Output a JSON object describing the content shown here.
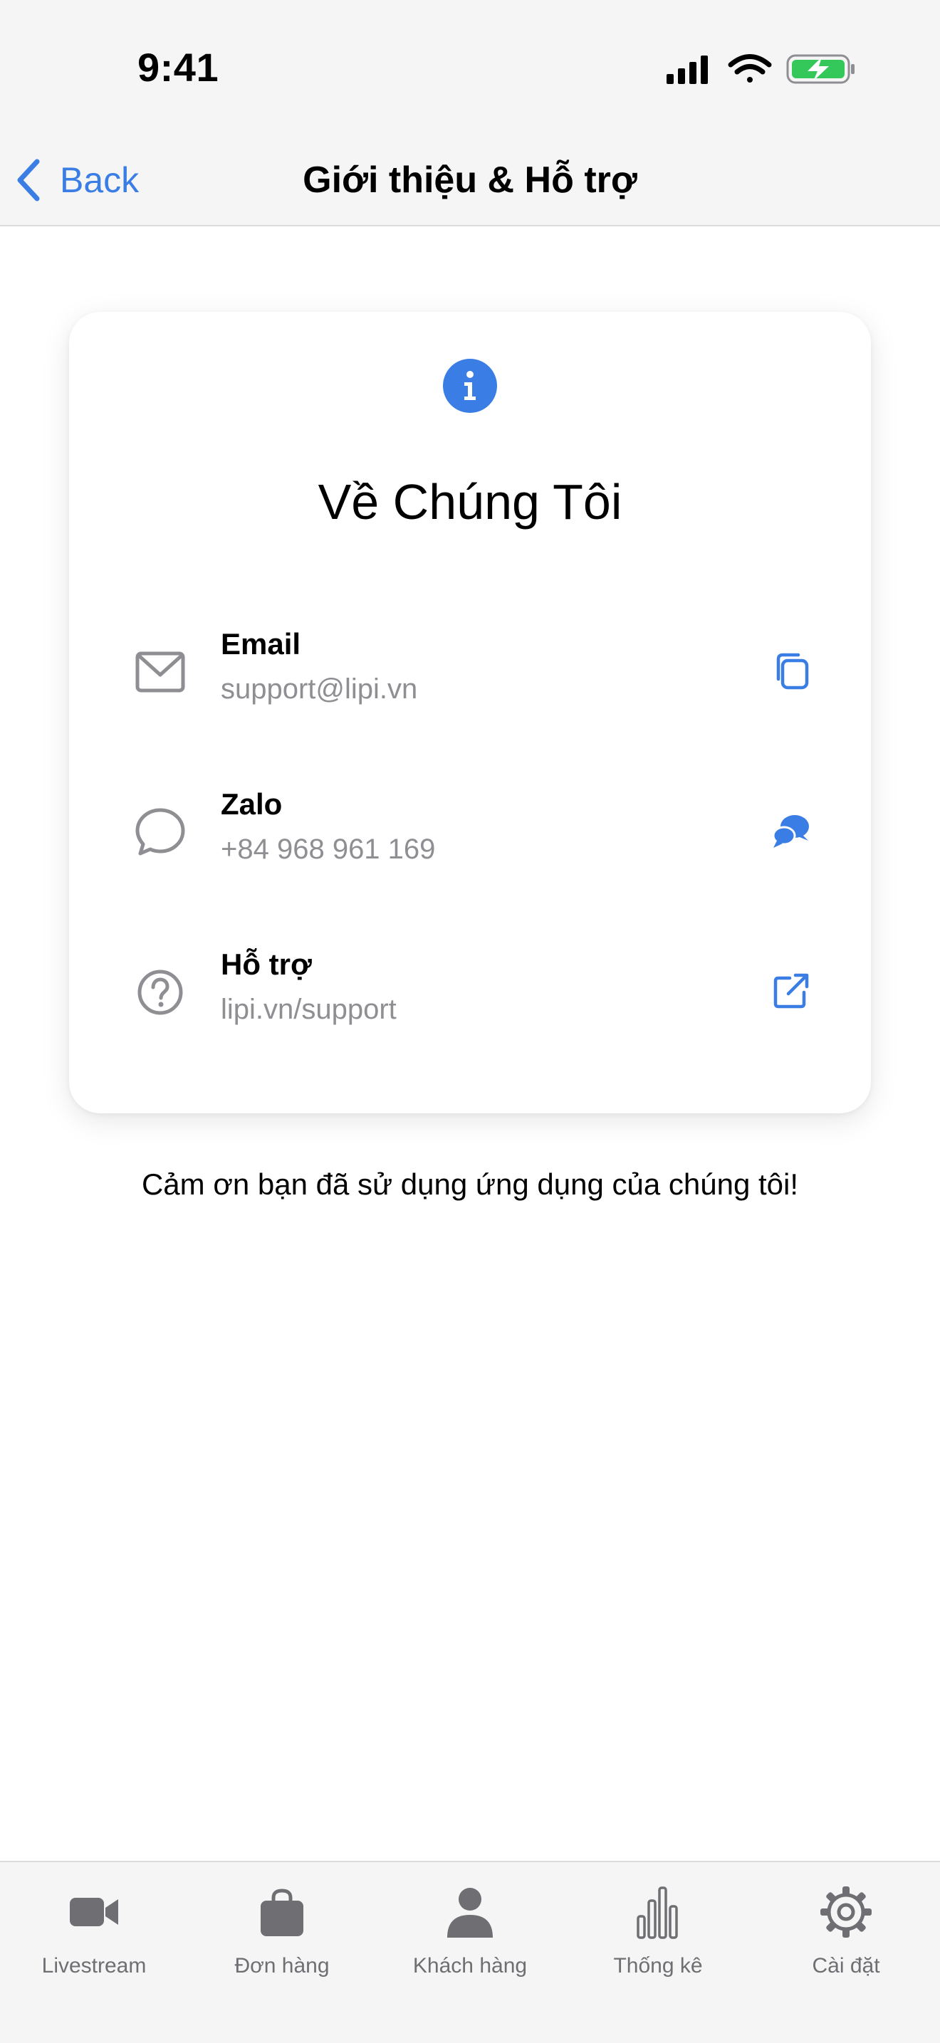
{
  "status_bar": {
    "time": "9:41",
    "battery_color": "#34c759"
  },
  "nav": {
    "back_label": "Back",
    "title": "Giới thiệu & Hỗ trợ"
  },
  "accent_color": "#3a7ee5",
  "card": {
    "title": "Về Chúng Tôi",
    "rows": [
      {
        "label": "Email",
        "value": "support@lipi.vn",
        "icon": "mail-icon",
        "action_icon": "copy-icon"
      },
      {
        "label": "Zalo",
        "value": "+84 968 961 169",
        "icon": "chat-bubble-icon",
        "action_icon": "chat-bubbles-icon"
      },
      {
        "label": "Hỗ trợ",
        "value": "lipi.vn/support",
        "icon": "question-circle-icon",
        "action_icon": "external-link-icon"
      }
    ]
  },
  "thanks_text": "Cảm ơn bạn đã sử dụng ứng dụng của chúng tôi!",
  "tabs": [
    {
      "label": "Livestream",
      "icon": "video-camera-icon"
    },
    {
      "label": "Đơn hàng",
      "icon": "shopping-bag-icon"
    },
    {
      "label": "Khách hàng",
      "icon": "person-icon"
    },
    {
      "label": "Thống kê",
      "icon": "bar-chart-icon"
    },
    {
      "label": "Cài đặt",
      "icon": "gear-icon"
    }
  ]
}
